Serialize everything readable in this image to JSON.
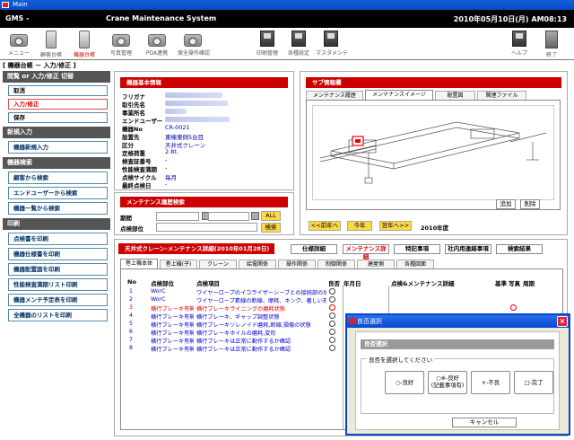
{
  "window_title": "Main",
  "header": {
    "left": "GMS -",
    "center": "Crane Maintenance System",
    "right": "2010年05月10日(月) AM08:13"
  },
  "toolbar": [
    {
      "label": "メニュー"
    },
    {
      "label": "顧客台帳"
    },
    {
      "label": "機器台帳"
    },
    {
      "label": "写真管理"
    },
    {
      "label": "PDA連携"
    },
    {
      "label": "保全操作確認"
    },
    {
      "label": "印刷管理"
    },
    {
      "label": "各種設定"
    },
    {
      "label": "マスタメンテ"
    },
    {
      "label": "ヘルプ"
    },
    {
      "label": "終了"
    }
  ],
  "page_title": "[ 機器台帳 － 入力/修正 ]",
  "left": {
    "sec1": "閲覧 or 入力/修正 切替",
    "cancel": "取消",
    "edit": "入力/修正",
    "save": "保存",
    "sec2": "新規入力",
    "new_entry": "機器新規入力",
    "sec3": "機器検索",
    "search_customer": "顧客から検索",
    "search_enduser": "エンドユーザーから検索",
    "search_list": "機器一覧から検索",
    "sec4": "印刷",
    "print1": "点検書を印刷",
    "print2": "機器仕様書を印刷",
    "print3": "機器配置図を印刷",
    "print4": "性能検査満期リスト印刷",
    "print5": "機器メンテ予定表を印刷",
    "print6": "全機器のリストを印刷"
  },
  "basic": {
    "title": "機器基本情報",
    "labels": [
      "フリガナ",
      "取引先名",
      "事業所名",
      "エンドユーザー",
      "機器No",
      "設置先",
      "区分",
      "定格荷重",
      "検査証番号",
      "性能検査満期",
      "点検サイクル",
      "最終点検日"
    ],
    "machine_no": "CR-0021",
    "location": "東棟東側5台目",
    "category": "天井式クレーン",
    "load": "2.8t.",
    "cert": "-",
    "expiry": "-",
    "cycle": "毎月",
    "last": "-"
  },
  "search": {
    "title": "メンテナンス履歴検索",
    "period": "期間",
    "item": "点検部位",
    "all": "ALL",
    "search": "検索"
  },
  "sub": {
    "title": "サブ情報欄",
    "tabs": [
      "メンテナンス履歴",
      "メンテナンスイメージ",
      "配置図",
      "関連ファイル"
    ],
    "add": "追加",
    "delete": "削除",
    "prev": "<<前年へ",
    "this": "今年",
    "next": "翌年へ>>",
    "year": "2010年度"
  },
  "maint": {
    "title": "天井式クレーン-メンテナンス詳細(2010年01月28日)",
    "right_tabs": [
      "仕様詳細",
      "メンテナンス詳細",
      "特記事項",
      "社内用連絡事項",
      "検索結果"
    ],
    "tabs": [
      "巻上機本体",
      "巻上機(子)",
      "クレーン",
      "給電関係",
      "操作関係",
      "制御関係",
      "建屋側",
      "各種図面"
    ],
    "headers": {
      "no": "No",
      "part": "点検部位",
      "item": "点検項目",
      "result": "良否",
      "month": "年月日",
      "detail": "点検&メンテナンス詳細",
      "std": "基準",
      "photo": "写真",
      "cycle": "周期"
    },
    "rows": [
      {
        "no": "1",
        "part": "WorC",
        "item": "ワイヤーロープのイコライザーシーブとの接続部の状態"
      },
      {
        "no": "2",
        "part": "WorC",
        "item": "ワイヤーロープ素線の断線、摩耗、キンク、著しい形くずれ、腐食状態"
      },
      {
        "no": "3",
        "part": "横行ブレーキ有無",
        "item": "横行ブレーキライニングの磨耗状態"
      },
      {
        "no": "4",
        "part": "横行ブレーキ有無",
        "item": "横行ブレーキ、ギャップ調整状態"
      },
      {
        "no": "5",
        "part": "横行ブレーキ有無",
        "item": "横行ブレーキソレノイド磨耗,断線,損傷の状態"
      },
      {
        "no": "6",
        "part": "横行ブレーキ有無",
        "item": "横行ブレーキホイルの磨耗,変形"
      },
      {
        "no": "7",
        "part": "横行ブレーキ有無",
        "item": "横行ブレーキは正常に動作するか確認"
      },
      {
        "no": "8",
        "part": "横行ブレーキ有無",
        "item": "横行ブレーキは正常に動作するか確認"
      }
    ]
  },
  "dialog": {
    "title": "良否選択",
    "section": "良否選択",
    "group": "良否を選択してください",
    "options": [
      {
        "line1": "○-良好",
        "line2": ""
      },
      {
        "line1": "○※-良好",
        "line2": "(記載事項有)"
      },
      {
        "line1": "×-不良",
        "line2": ""
      },
      {
        "line1": "□-完了",
        "line2": ""
      }
    ],
    "cancel": "キャンセル"
  }
}
